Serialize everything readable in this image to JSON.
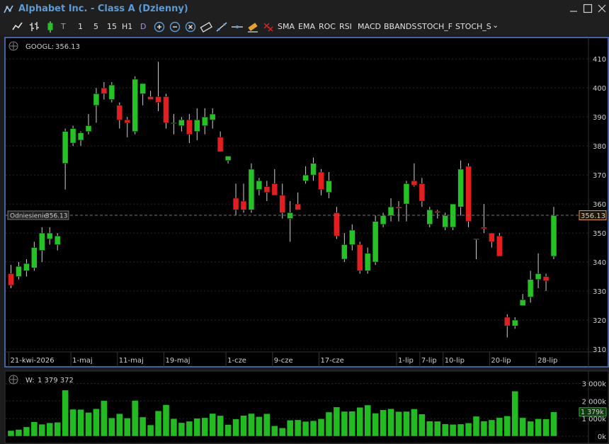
{
  "window": {
    "title": "Alphabet Inc. - Class A (Dzienny)"
  },
  "toolbar": {
    "timeframes": [
      "1",
      "5",
      "15",
      "H1",
      "D"
    ],
    "indicators": [
      "SMA",
      "EMA",
      "ROC",
      "RSI",
      "MACD",
      "BBANDS",
      "STOCH_F",
      "STOCH_S"
    ],
    "more_symbol": "⌄"
  },
  "price_panel": {
    "symbol": "GOOGL:",
    "last": "356.13",
    "reference_label": "Odniesienie",
    "reference_value": "356.13",
    "last_price_tag": "356.13"
  },
  "volume_panel": {
    "label": "W:",
    "value": "1 379 372",
    "last_tag": "1 379k"
  },
  "colors": {
    "up": "#22c322",
    "down": "#e41e1e",
    "accent": "#5b9bd5",
    "volume": "#22bb22",
    "tag": "#e8a030"
  },
  "chart_data": [
    {
      "type": "candlestick",
      "title": "GOOGL",
      "ylim": [
        310,
        412
      ],
      "y_ticks": [
        310,
        320,
        330,
        340,
        350,
        360,
        370,
        380,
        390,
        400,
        410
      ],
      "x_labels": [
        {
          "label": "21-kwi-2026",
          "index": 0
        },
        {
          "label": "1-maj",
          "index": 8
        },
        {
          "label": "11-maj",
          "index": 14
        },
        {
          "label": "19-maj",
          "index": 20
        },
        {
          "label": "1-cze",
          "index": 28
        },
        {
          "label": "9-cze",
          "index": 34
        },
        {
          "label": "17-cze",
          "index": 40
        },
        {
          "label": "1-lip",
          "index": 50
        },
        {
          "label": "7-lip",
          "index": 53
        },
        {
          "label": "10-lip",
          "index": 56
        },
        {
          "label": "20-lip",
          "index": 62
        },
        {
          "label": "28-lip",
          "index": 68
        }
      ],
      "reference": 356.13,
      "candles": [
        {
          "o": 336,
          "h": 339,
          "l": 331,
          "c": 332
        },
        {
          "o": 335,
          "h": 340,
          "l": 334,
          "c": 338.5
        },
        {
          "o": 337,
          "h": 341,
          "l": 335,
          "c": 339.5
        },
        {
          "o": 338,
          "h": 347,
          "l": 337,
          "c": 345
        },
        {
          "o": 344,
          "h": 352,
          "l": 340,
          "c": 350
        },
        {
          "o": 348,
          "h": 352,
          "l": 346,
          "c": 350
        },
        {
          "o": 346,
          "h": 350,
          "l": 344,
          "c": 349
        },
        {
          "o": 374,
          "h": 386,
          "l": 365,
          "c": 385
        },
        {
          "o": 381,
          "h": 387,
          "l": 380,
          "c": 386
        },
        {
          "o": 382,
          "h": 385,
          "l": 380,
          "c": 384.5
        },
        {
          "o": 385,
          "h": 391,
          "l": 384,
          "c": 387
        },
        {
          "o": 394,
          "h": 400,
          "l": 388,
          "c": 398
        },
        {
          "o": 400,
          "h": 402,
          "l": 396,
          "c": 398
        },
        {
          "o": 396,
          "h": 402,
          "l": 395,
          "c": 401
        },
        {
          "o": 394,
          "h": 395,
          "l": 386,
          "c": 389
        },
        {
          "o": 389,
          "h": 390,
          "l": 383,
          "c": 388
        },
        {
          "o": 385,
          "h": 404,
          "l": 384,
          "c": 403
        },
        {
          "o": 398,
          "h": 400,
          "l": 394,
          "c": 401.5
        },
        {
          "o": 397,
          "h": 399,
          "l": 396,
          "c": 396
        },
        {
          "o": 397,
          "h": 409,
          "l": 392,
          "c": 395
        },
        {
          "o": 397,
          "h": 398,
          "l": 386,
          "c": 388
        },
        {
          "o": 388,
          "h": 391,
          "l": 384,
          "c": 388
        },
        {
          "o": 387,
          "h": 390,
          "l": 385,
          "c": 389
        },
        {
          "o": 389,
          "h": 391,
          "l": 381,
          "c": 384
        },
        {
          "o": 385,
          "h": 393,
          "l": 382,
          "c": 389
        },
        {
          "o": 387,
          "h": 393,
          "l": 384,
          "c": 390
        },
        {
          "o": 389,
          "h": 393,
          "l": 386,
          "c": 391
        },
        {
          "o": 383,
          "h": 385,
          "l": 379,
          "c": 378
        },
        {
          "o": 375,
          "h": 376,
          "l": 374,
          "c": 376.5
        },
        {
          "o": 362,
          "h": 367,
          "l": 356,
          "c": 358
        },
        {
          "o": 361,
          "h": 367,
          "l": 357,
          "c": 358
        },
        {
          "o": 358,
          "h": 374,
          "l": 357,
          "c": 372
        },
        {
          "o": 365,
          "h": 369,
          "l": 363,
          "c": 368
        },
        {
          "o": 366,
          "h": 368,
          "l": 361,
          "c": 364
        },
        {
          "o": 367,
          "h": 372,
          "l": 364,
          "c": 363
        },
        {
          "o": 363,
          "h": 367,
          "l": 355,
          "c": 357
        },
        {
          "o": 355,
          "h": 361,
          "l": 347,
          "c": 357
        },
        {
          "o": 360,
          "h": 364,
          "l": 359,
          "c": 358
        },
        {
          "o": 368,
          "h": 373,
          "l": 367,
          "c": 370
        },
        {
          "o": 370,
          "h": 376,
          "l": 368,
          "c": 374
        },
        {
          "o": 371,
          "h": 372,
          "l": 363,
          "c": 365
        },
        {
          "o": 364,
          "h": 371,
          "l": 362,
          "c": 368
        },
        {
          "o": 357,
          "h": 359,
          "l": 348,
          "c": 349
        },
        {
          "o": 341,
          "h": 350,
          "l": 340,
          "c": 346
        },
        {
          "o": 346,
          "h": 353,
          "l": 344,
          "c": 351
        },
        {
          "o": 346,
          "h": 347,
          "l": 336,
          "c": 337
        },
        {
          "o": 337,
          "h": 345,
          "l": 336,
          "c": 343
        },
        {
          "o": 340,
          "h": 356,
          "l": 339,
          "c": 354
        },
        {
          "o": 353,
          "h": 357,
          "l": 352,
          "c": 356
        },
        {
          "o": 356,
          "h": 362,
          "l": 354,
          "c": 359
        },
        {
          "o": 359,
          "h": 361,
          "l": 354,
          "c": 358.5
        },
        {
          "o": 360,
          "h": 368,
          "l": 354,
          "c": 367
        },
        {
          "o": 368,
          "h": 374,
          "l": 366,
          "c": 366.5
        },
        {
          "o": 367,
          "h": 369,
          "l": 359,
          "c": 361
        },
        {
          "o": 353,
          "h": 359,
          "l": 352,
          "c": 358
        },
        {
          "o": 357.5,
          "h": 358,
          "l": 355,
          "c": 357
        },
        {
          "o": 352,
          "h": 357,
          "l": 351,
          "c": 356
        },
        {
          "o": 352,
          "h": 360,
          "l": 351,
          "c": 360
        },
        {
          "o": 359,
          "h": 375,
          "l": 356,
          "c": 372
        },
        {
          "o": 373,
          "h": 374,
          "l": 352,
          "c": 354
        },
        {
          "o": 348,
          "h": 348,
          "l": 341,
          "c": 348
        },
        {
          "o": 352,
          "h": 360,
          "l": 350,
          "c": 351.5
        },
        {
          "o": 350,
          "h": 350,
          "l": 345,
          "c": 347
        },
        {
          "o": 349,
          "h": 350,
          "l": 342,
          "c": 342
        },
        {
          "o": 321,
          "h": 322,
          "l": 314,
          "c": 318
        },
        {
          "o": 318,
          "h": 321,
          "l": 317,
          "c": 320
        },
        {
          "o": 325,
          "h": 329,
          "l": 325,
          "c": 327
        },
        {
          "o": 328,
          "h": 337,
          "l": 326,
          "c": 334
        },
        {
          "o": 334,
          "h": 343,
          "l": 331,
          "c": 336
        },
        {
          "o": 335,
          "h": 336,
          "l": 330,
          "c": 333.5
        },
        {
          "o": 342,
          "h": 359,
          "l": 341,
          "c": 356
        }
      ]
    },
    {
      "type": "bar",
      "title": "Volume",
      "ylim": [
        0,
        3300
      ],
      "y_tick_labels": [
        "0k",
        "1 000k",
        "2 000k",
        "3 000k"
      ],
      "values": [
        320,
        380,
        530,
        820,
        680,
        760,
        790,
        2620,
        1530,
        1520,
        1350,
        1560,
        2020,
        1040,
        1280,
        1030,
        2030,
        1090,
        640,
        1440,
        1790,
        1000,
        770,
        850,
        1020,
        1050,
        1290,
        1170,
        660,
        980,
        1180,
        1290,
        1110,
        1280,
        590,
        470,
        910,
        930,
        840,
        880,
        990,
        1370,
        1660,
        1410,
        1420,
        1640,
        1770,
        1310,
        1500,
        1560,
        1400,
        1410,
        1550,
        1260,
        860,
        850,
        700,
        670,
        690,
        750,
        1130,
        860,
        930,
        1060,
        1150,
        2560,
        1050,
        850,
        990,
        980,
        1379
      ]
    }
  ]
}
